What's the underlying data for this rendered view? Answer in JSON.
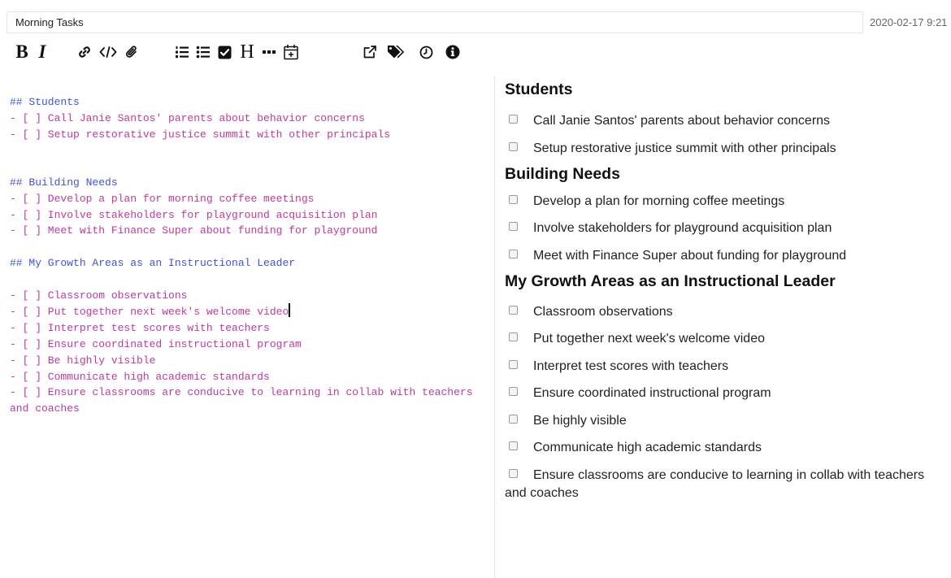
{
  "header": {
    "title_value": "Morning Tasks",
    "timestamp": "2020-02-17 9:21"
  },
  "toolbar": {
    "bold_label": "B",
    "italic_label": "I",
    "heading_label": "H"
  },
  "editor_lines": [
    {
      "type": "header",
      "text": "## Students"
    },
    {
      "type": "task",
      "text": "- [ ] Call Janie Santos' parents about behavior concerns"
    },
    {
      "type": "task",
      "text": "- [ ] Setup restorative justice summit with other principals"
    },
    {
      "type": "blank",
      "text": ""
    },
    {
      "type": "blank",
      "text": ""
    },
    {
      "type": "header",
      "text": "## Building Needs"
    },
    {
      "type": "task",
      "text": "- [ ] Develop a plan for morning coffee meetings"
    },
    {
      "type": "task",
      "text": "- [ ] Involve stakeholders for playground acquisition plan"
    },
    {
      "type": "task",
      "text": "- [ ] Meet with Finance Super about funding for playground"
    },
    {
      "type": "blank",
      "text": ""
    },
    {
      "type": "header",
      "text": "## My Growth Areas as an Instructional Leader"
    },
    {
      "type": "blank",
      "text": ""
    },
    {
      "type": "task",
      "text": "- [ ] Classroom observations"
    },
    {
      "type": "task",
      "text": "- [ ] Put together next week's welcome video",
      "caret": true
    },
    {
      "type": "task",
      "text": "- [ ] Interpret test scores with teachers"
    },
    {
      "type": "task",
      "text": "- [ ] Ensure coordinated instructional program"
    },
    {
      "type": "task",
      "text": "- [ ] Be highly visible"
    },
    {
      "type": "task",
      "text": "- [ ] Communicate high academic standards"
    },
    {
      "type": "task",
      "text": "- [ ] Ensure classrooms are conducive to learning in collab with teachers and coaches"
    }
  ],
  "preview": {
    "sections": [
      {
        "title": "Students",
        "items": [
          "Call Janie Santos' parents about behavior concerns",
          "Setup restorative justice summit with other principals"
        ]
      },
      {
        "title": "Building Needs",
        "items": [
          "Develop a plan for morning coffee meetings",
          "Involve stakeholders for playground acquisition plan",
          "Meet with Finance Super about funding for playground"
        ]
      },
      {
        "title": "My Growth Areas as an Instructional Leader",
        "items": [
          "Classroom observations",
          "Put together next week's welcome video",
          "Interpret test scores with teachers",
          "Ensure coordinated instructional program",
          "Be highly visible",
          "Communicate high academic standards",
          "Ensure classrooms are conducive to learning in collab with teachers and coaches"
        ]
      }
    ]
  },
  "icons": {
    "link": "link-icon",
    "code": "code-icon",
    "attach": "paperclip-icon",
    "ordered_list": "ordered-list-icon",
    "bullet_list": "bullet-list-icon",
    "checkbox": "checkbox-icon",
    "hr": "horizontal-rule-icon",
    "date": "calendar-add-icon",
    "external": "external-link-icon",
    "tags": "tags-icon",
    "history": "clock-icon",
    "info": "info-icon"
  }
}
